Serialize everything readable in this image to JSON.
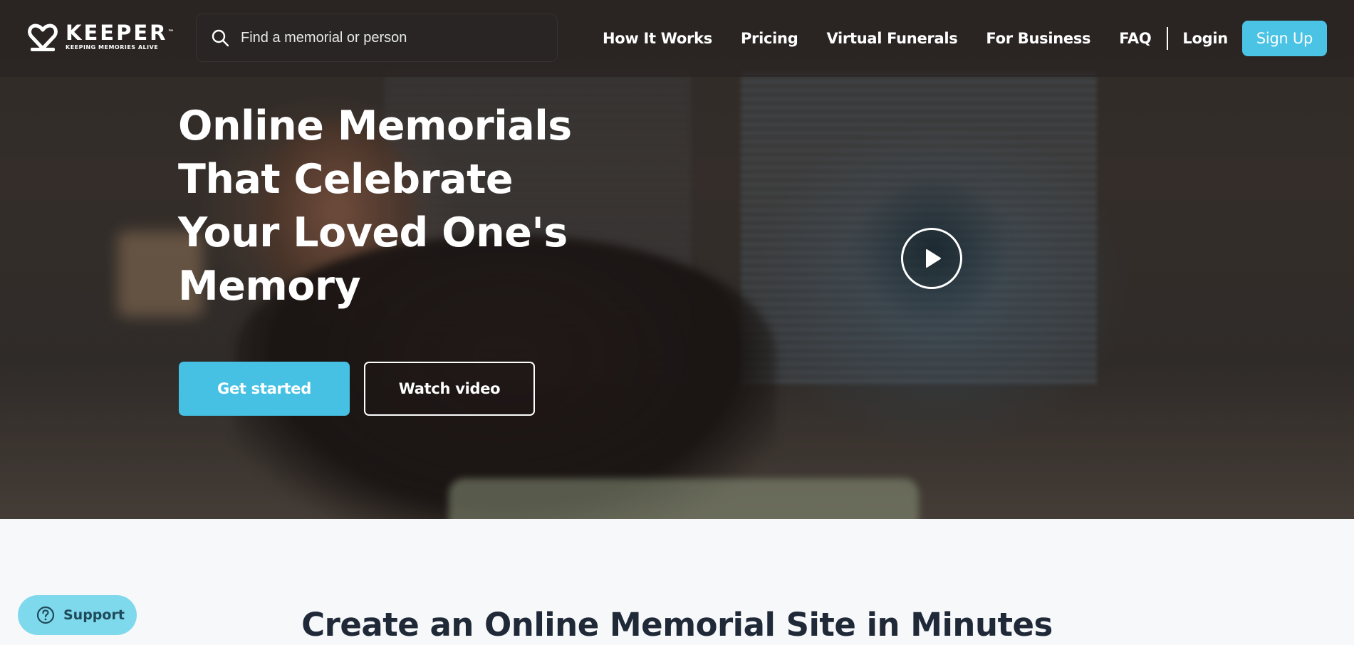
{
  "brand": {
    "name": "KEEPER",
    "trademark": "™",
    "tagline": "KEEPING MEMORIES ALIVE",
    "accent_color": "#47c1e3"
  },
  "search": {
    "placeholder": "Find a memorial or person",
    "icon": "search-icon"
  },
  "nav": {
    "links": [
      "How It Works",
      "Pricing",
      "Virtual Funerals",
      "For Business",
      "FAQ"
    ],
    "login_label": "Login",
    "signup_label": "Sign Up"
  },
  "hero": {
    "title": "Online Memorials That Celebrate Your Loved One's Memory",
    "primary_cta": "Get started",
    "secondary_cta": "Watch video",
    "play_icon": "play-icon"
  },
  "section": {
    "title": "Create an Online Memorial Site in Minutes"
  },
  "support": {
    "label": "Support",
    "icon": "help-icon",
    "color": "#7fd9ec"
  }
}
